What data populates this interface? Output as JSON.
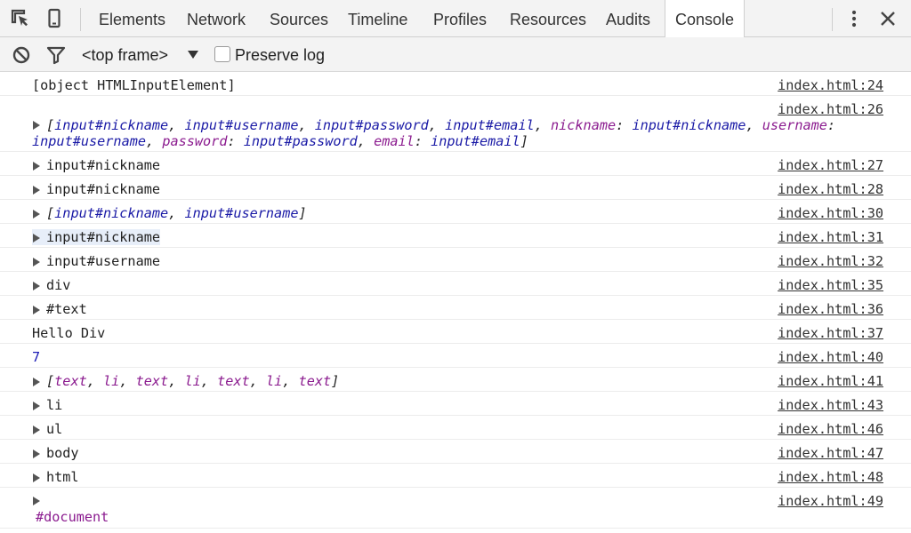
{
  "toolbar_tabs": {
    "elements": "Elements",
    "network": "Network",
    "sources": "Sources",
    "timeline": "Timeline",
    "profiles": "Profiles",
    "resources": "Resources",
    "audits": "Audits",
    "console": "Console"
  },
  "console_toolbar": {
    "frame": "<top frame>",
    "preserve_log": "Preserve log"
  },
  "rows": [
    {
      "text": "[object HTMLInputElement]",
      "src": "index.html:24"
    },
    {
      "text": "[input#nickname, input#username, input#password, input#email, nickname: input#nickname, username: input#username, password: input#password, email: input#email]",
      "src": "index.html:26"
    },
    {
      "text": "input#nickname",
      "src": "index.html:27"
    },
    {
      "text": "input#nickname",
      "src": "index.html:28"
    },
    {
      "text": "[input#nickname, input#username]",
      "src": "index.html:30"
    },
    {
      "text": "input#nickname",
      "src": "index.html:31"
    },
    {
      "text": "input#username",
      "src": "index.html:32"
    },
    {
      "text": "div",
      "src": "index.html:35"
    },
    {
      "text": "#text",
      "src": "index.html:36"
    },
    {
      "text": "Hello Div",
      "src": "index.html:37"
    },
    {
      "text": "7",
      "src": "index.html:40"
    },
    {
      "text": "[text, li, text, li, text, li, text]",
      "src": "index.html:41"
    },
    {
      "text": "li",
      "src": "index.html:43"
    },
    {
      "text": "ul",
      "src": "index.html:46"
    },
    {
      "text": "body",
      "src": "index.html:47"
    },
    {
      "text": "html",
      "src": "index.html:48"
    },
    {
      "text": "#document",
      "src": "index.html:49"
    }
  ],
  "colors": {
    "node_purple": "#8b1b8f",
    "value_blue": "#1a1aa6",
    "highlight": "#e7eef9"
  }
}
